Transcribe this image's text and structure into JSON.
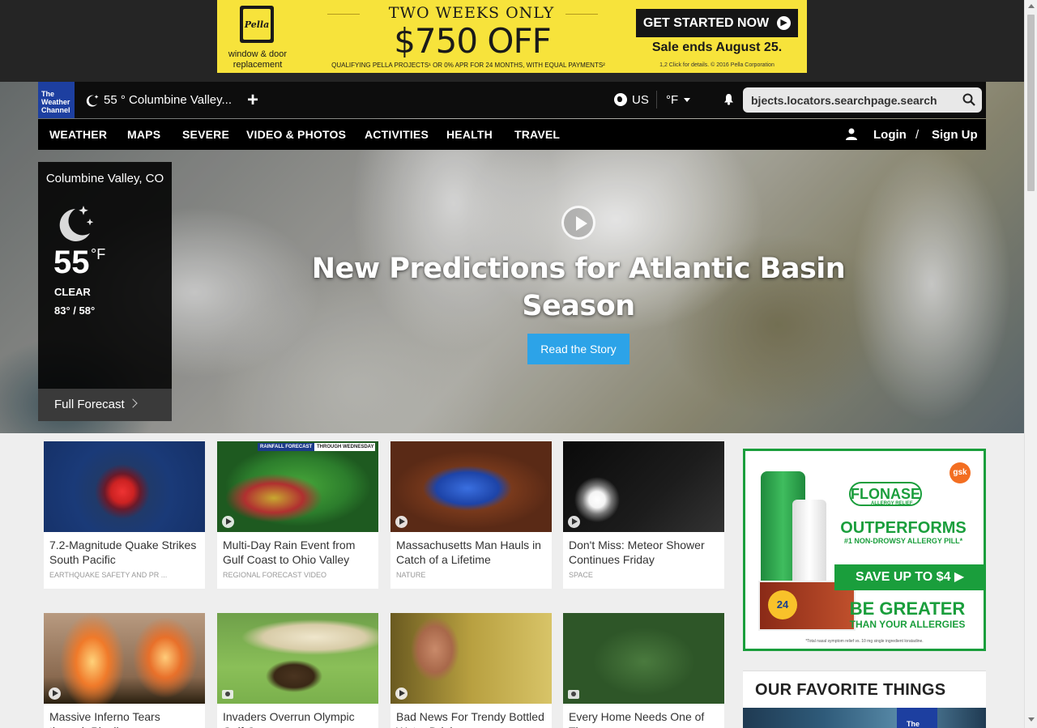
{
  "ad_top": {
    "brand": "Pella",
    "tagline": "window & door replacement",
    "headline": "TWO WEEKS ONLY",
    "price": "$750 OFF",
    "fine_print": "QUALIFYING PELLA PROJECTS¹ OR 0% APR FOR 24 MONTHS, WITH EQUAL PAYMENTS²",
    "cta": "GET STARTED NOW",
    "sale_end": "Sale ends August 25.",
    "sale_fine": "1,2 Click for details. © 2016 Pella Corporation",
    "bg_color": "#f7e33b"
  },
  "header": {
    "logo_text": "The Weather Channel",
    "location": "55 ° Columbine Valley...",
    "add_label": "+",
    "region": "US",
    "unit": "°F",
    "search_value": "bjects.locators.searchpage.search",
    "brand_color": "#1d3fa0"
  },
  "nav": {
    "items": [
      "WEATHER",
      "MAPS",
      "SEVERE",
      "VIDEO & PHOTOS",
      "ACTIVITIES",
      "HEALTH",
      "TRAVEL"
    ],
    "login": "Login",
    "separator": "/",
    "signup": "Sign Up"
  },
  "current": {
    "location": "Columbine Valley, CO",
    "temp": "55",
    "unit": "°F",
    "condition": "CLEAR",
    "hilo": "83° / 58°",
    "icon": "moon-stars-icon",
    "full_forecast": "Full Forecast"
  },
  "hero": {
    "title": "New Predictions for Atlantic Basin Season",
    "button": "Read the Story",
    "button_color": "#2ca3e8"
  },
  "cards": [
    {
      "title": "7.2-Magnitude Quake Strikes South Pacific",
      "category": "EARTHQUAKE SAFETY AND PR ...",
      "media": "none"
    },
    {
      "title": "Multi-Day Rain Event from Gulf Coast to Ohio Valley",
      "category": "REGIONAL FORECAST VIDEO",
      "media": "video",
      "overlay_left": "RAINFALL FORECAST",
      "overlay_right": "THROUGH WEDNESDAY"
    },
    {
      "title": "Massachusetts Man Hauls in Catch of a Lifetime",
      "category": "NATURE",
      "media": "video"
    },
    {
      "title": "Don't Miss: Meteor Shower Continues Friday",
      "category": "SPACE",
      "media": "video"
    },
    {
      "title": "Massive Inferno Tears through Pipeline",
      "category": "",
      "media": "video"
    },
    {
      "title": "Invaders Overrun Olympic Golf Course",
      "category": "",
      "media": "photo"
    },
    {
      "title": "Bad News For Trendy Bottled Water Drinkers",
      "category": "",
      "media": "video"
    },
    {
      "title": "Every Home Needs One of These",
      "category": "",
      "media": "photo"
    }
  ],
  "ad_right": {
    "brand": "FLONASE",
    "brand_sub": "ALLERGY RELIEF",
    "maker": "gsk",
    "headline": "OUTPERFORMS",
    "sub": "#1 NON-DROWSY ALLERGY PILL*",
    "save": "SAVE UP TO $4 ▶",
    "badge": "24",
    "slogan": "BE GREATER",
    "slogan_sub": "THAN YOUR ALLERGIES",
    "fine": "*Total nasal symptom relief vs. 10 mg single ingredient loratadine.",
    "color": "#1a9e3c"
  },
  "favorites": {
    "title": "OUR FAVORITE THINGS",
    "logo_text": "The"
  }
}
